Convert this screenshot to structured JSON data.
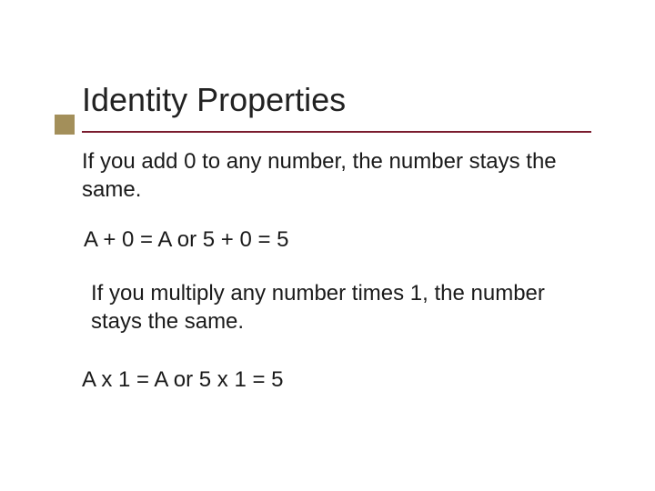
{
  "title": "Identity Properties",
  "addition_rule": "If you add 0 to any number, the number stays the same.",
  "addition_equation": "A + 0 = A   or  5 + 0 = 5",
  "multiplication_rule": "If you multiply any number times 1, the number stays the same.",
  "multiplication_equation": "A x 1 = A    or 5 x 1 = 5"
}
